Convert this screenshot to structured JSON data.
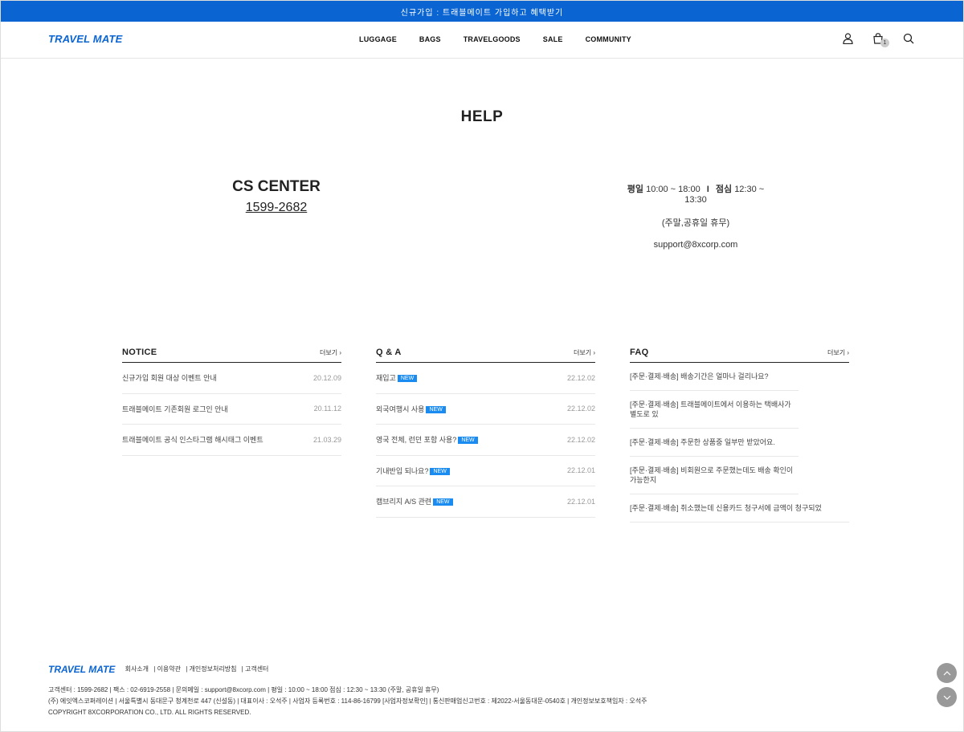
{
  "topbar": {
    "text": "신규가입 : 트래블메이트 가입하고 혜택받기"
  },
  "header": {
    "logo": "TRAVEL MATE",
    "nav": [
      "LUGGAGE",
      "BAGS",
      "TRAVELGOODS",
      "SALE",
      "COMMUNITY"
    ],
    "cart_count": "1"
  },
  "page_title": "HELP",
  "cs": {
    "title": "CS CENTER",
    "phone": "1599-2682",
    "weekday_label": "평일",
    "weekday_hours": "10:00 ~ 18:00",
    "lunch_label": "점심",
    "lunch_hours": "12:30 ~ 13:30",
    "sep": "I",
    "closed": "(주말,공휴일 휴무)",
    "email": "support@8xcorp.com"
  },
  "boards": {
    "more_label": "더보기",
    "notice": {
      "title": "NOTICE",
      "items": [
        {
          "text": "신규가입 회원 대상 이벤트 안내",
          "date": "20.12.09"
        },
        {
          "text": "트래블메이트 기존회원 로그인 안내",
          "date": "20.11.12"
        },
        {
          "text": "트래블메이트 공식 인스타그램 해시태그 이벤트",
          "date": "21.03.29"
        }
      ]
    },
    "qna": {
      "title": "Q & A",
      "new_label": "NEW",
      "items": [
        {
          "text": "재입고",
          "date": "22.12.02"
        },
        {
          "text": "외국여행시 사용",
          "date": "22.12.02"
        },
        {
          "text": "영국 전체, 런던 포함 사용?",
          "date": "22.12.02"
        },
        {
          "text": "기내반입 되나요?",
          "date": "22.12.01"
        },
        {
          "text": "캠브리지 A/S 관련",
          "date": "22.12.01"
        }
      ]
    },
    "faq": {
      "title": "FAQ",
      "items": [
        "[주문·결제·배송] 배송기간은 얼마나 걸리나요?",
        "[주문·결제·배송] 트래블메이트에서 이용하는 택배사가 별도로 있",
        "[주문·결제·배송] 주문한 상품중 일부만 받았어요.",
        "[주문·결제·배송] 비회원으로 주문했는데도 배송 확인이 가능한지",
        "[주문·결제·배송] 취소했는데 신용카드 청구서에 금액이 청구되었"
      ]
    }
  },
  "footer": {
    "logo": "TRAVEL MATE",
    "links": [
      "회사소개",
      "이용약관",
      "개인정보처리방침",
      "고객센터"
    ],
    "line1": "고객센터 : 1599-2682  |  팩스 : 02-6919-2558  |  문의메일 : support@8xcorp.com  |  평일 : 10:00 ~ 18:00 점심 : 12:30 ~ 13:30 (주말, 공휴일 휴무)",
    "line2": "(주) 에잇엑스코퍼레이션  |  서울특별시 동대문구 청계천로 447 (신설동)  |  대표이사 : 오석주  |  사업자 등록번호 : 114-86-16799 [사업자정보확인]  |  통신판매업신고번호 : 제2022-서울동대문-0540호  |  개인정보보호책임자 : 오석주",
    "copyright": "COPYRIGHT 8XCORPORATION CO., LTD. ALL RIGHTS RESERVED."
  }
}
